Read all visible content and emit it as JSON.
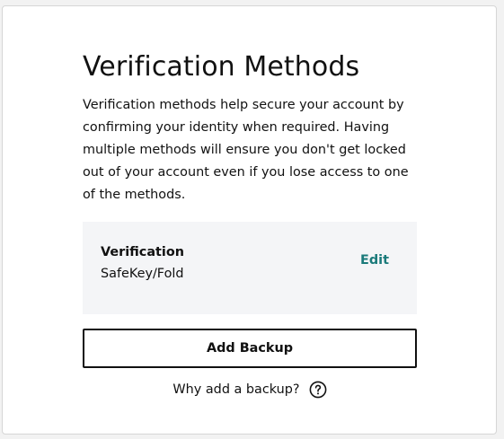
{
  "page": {
    "title": "Verification Methods",
    "description": "Verification methods help secure your account by confirming your identity when required. Having multiple methods will ensure you don't get locked out of your account even if you lose access to one of the methods."
  },
  "methods": [
    {
      "name": "Verification",
      "value": "SafeKey/Fold",
      "action_label": "Edit"
    }
  ],
  "actions": {
    "add_backup_label": "Add Backup",
    "why_label": "Why add a backup?",
    "help_icon": "question-circle-icon"
  },
  "colors": {
    "accent": "#1a7a7a",
    "method_background": "#f4f5f7",
    "page_background": "#f2f2f2"
  }
}
